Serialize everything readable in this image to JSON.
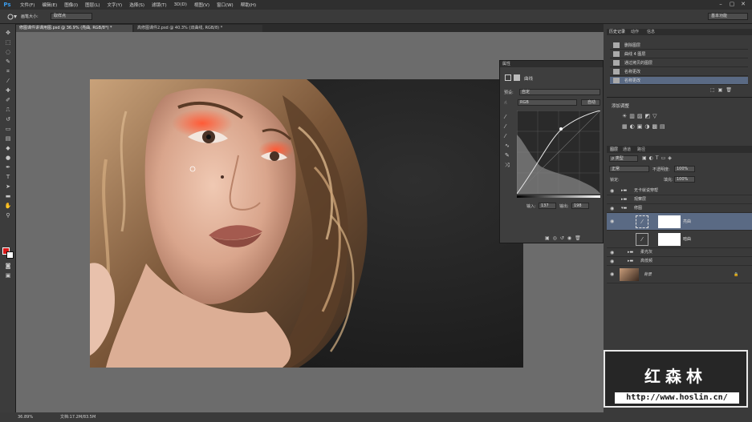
{
  "app": {
    "logo": "Ps"
  },
  "menu": [
    "文件(F)",
    "编辑(E)",
    "图像(I)",
    "图层(L)",
    "文字(Y)",
    "选择(S)",
    "滤镜(T)",
    "3D(D)",
    "视图(V)",
    "窗口(W)",
    "帮助(H)"
  ],
  "window_controls": [
    "–",
    "▢",
    "✕"
  ],
  "options": {
    "brush_size_label": "画笔大小:",
    "sample_value": "取样点",
    "workspace": "基本功能"
  },
  "tabs": [
    {
      "label": "修图课件讲课用图.psd @ 36.9% (亮曲, RGB/8*) *",
      "active": true
    },
    {
      "label": "高修图课件2.psd @ 40.3% (双曲线, RGB/8) *",
      "active": false
    }
  ],
  "status": {
    "zoom": "36.89%",
    "doc": "文档:17.2M/83.5M"
  },
  "history": {
    "tabs": [
      "历史记录",
      "动作",
      "信息"
    ],
    "items": [
      "删除图层",
      "曲线 4 图层",
      "通过拷贝的图层",
      "名称更改",
      "名称更改"
    ]
  },
  "adjustments": {
    "title": "添加调整"
  },
  "layers": {
    "tabs": [
      "图层",
      "通道",
      "路径"
    ],
    "kind": "ρ 类型",
    "blend_mode": "正常",
    "opacity_label": "不透明度:",
    "opacity_value": "100%",
    "lock_label": "锁定:",
    "fill_label": "填充:",
    "fill_value": "100%",
    "rows": [
      {
        "name": "无卡就说穿帮",
        "type": "group"
      },
      {
        "name": "观察层",
        "type": "group"
      },
      {
        "name": "修图",
        "type": "group-open"
      },
      {
        "name": "亮曲",
        "type": "curves",
        "selected": true
      },
      {
        "name": "暗曲",
        "type": "curves"
      },
      {
        "name": "柔光灰",
        "type": "group"
      },
      {
        "name": "高低频",
        "type": "group"
      },
      {
        "name": "背景",
        "type": "image"
      }
    ]
  },
  "properties": {
    "title": "属性",
    "subtitle": "曲线",
    "preset_label": "预设:",
    "preset_value": "自定",
    "channel": "RGB",
    "auto": "自动",
    "input_label": "输入:",
    "input_value": "137",
    "output_label": "输出:",
    "output_value": "198"
  },
  "watermark": {
    "title": "红森林",
    "url": "http://www.hoslin.cn/"
  }
}
